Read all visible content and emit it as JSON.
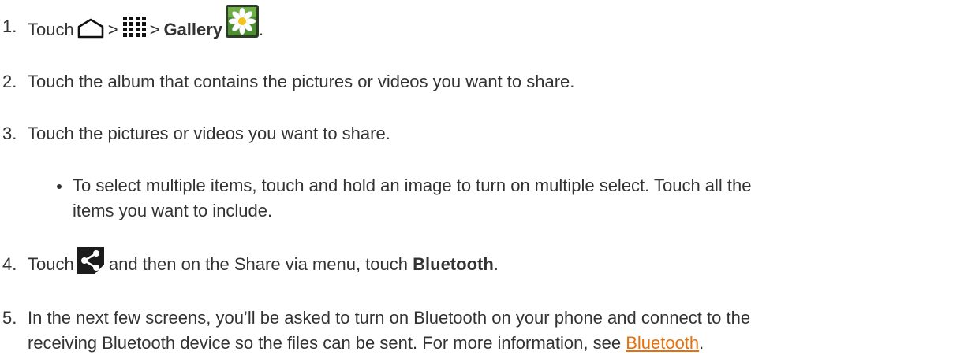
{
  "steps": [
    {
      "number": "1.",
      "text_before": "Touch",
      "sep1": ">",
      "sep2": ">",
      "bold_label": "Gallery",
      "trailing": "."
    },
    {
      "number": "2.",
      "text": "Touch the album that contains the pictures or videos you want to share."
    },
    {
      "number": "3.",
      "text": "Touch the pictures or videos you want to share."
    },
    {
      "number": "4.",
      "text_before": "Touch",
      "text_middle": "and then on the Share via menu, touch",
      "bold_label": "Bluetooth",
      "trailing": "."
    },
    {
      "number": "5.",
      "line1": "In the next few screens, you’ll be asked to turn on Bluetooth on your phone and connect to the",
      "line2_before": "receiving Bluetooth device so the files can be sent. For more information, see",
      "link_text": "Bluetooth",
      "trailing": "."
    }
  ],
  "bullet": {
    "line1": "To select multiple items, touch and hold an image to turn on multiple select. Touch all the",
    "line2": "items you want to include."
  },
  "icons": {
    "home": "home-icon",
    "apps": "apps-grid-icon",
    "gallery": "gallery-flower-icon",
    "share": "share-icon"
  },
  "colors": {
    "text": "#333333",
    "link": "#e8700b"
  }
}
